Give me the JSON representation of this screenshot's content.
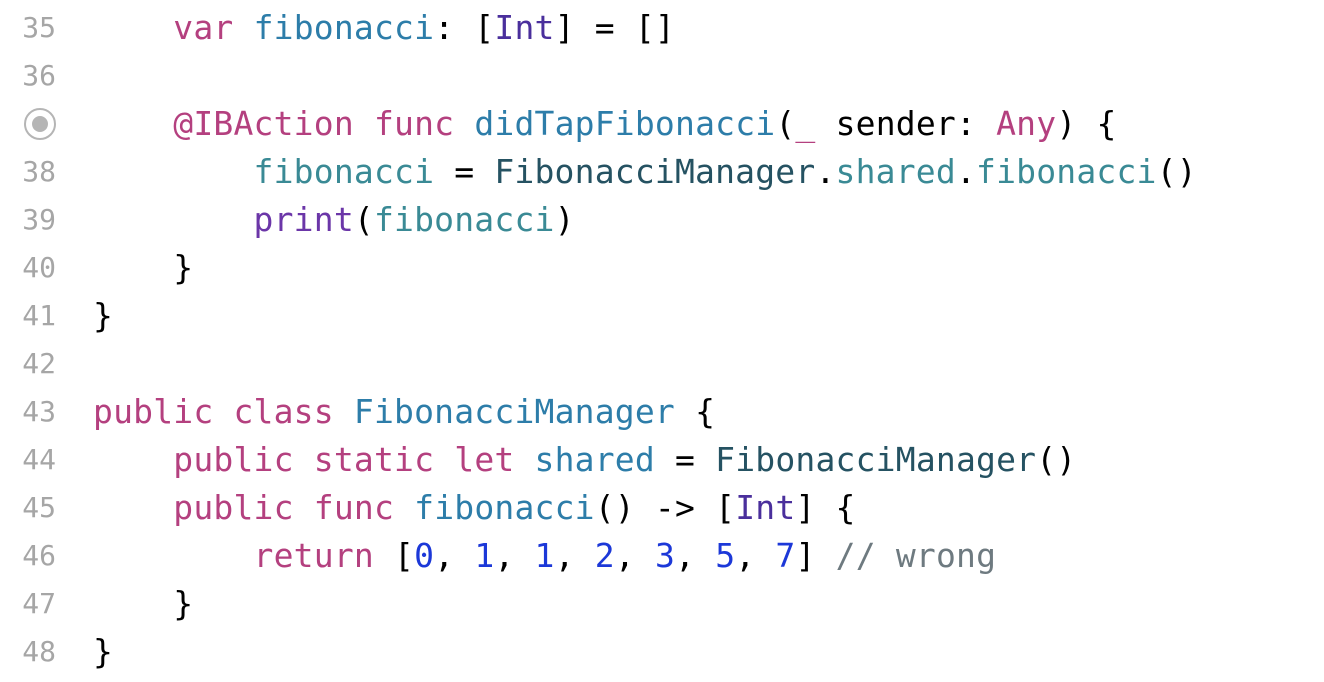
{
  "colors": {
    "keyword": "#b4407f",
    "declaration": "#2d7da9",
    "type": "#4a2f9c",
    "type_ref": "#255262",
    "member": "#3a8a95",
    "builtin_func": "#6b36a8",
    "number": "#1c38d8",
    "comment": "#6e7a80",
    "plain": "#000000",
    "line_number": "#a6a6a6"
  },
  "lines": [
    {
      "number": "35",
      "tokens": [
        {
          "text": "    "
        },
        {
          "text": "var",
          "kind": "keyword"
        },
        {
          "text": " "
        },
        {
          "text": "fibonacci",
          "kind": "declaration"
        },
        {
          "text": ": ["
        },
        {
          "text": "Int",
          "kind": "type"
        },
        {
          "text": "] = []"
        }
      ]
    },
    {
      "number": "36",
      "tokens": []
    },
    {
      "number": "",
      "breakpoint_icon": "breakpoint-connection-icon",
      "tokens": [
        {
          "text": "    "
        },
        {
          "text": "@IBAction",
          "kind": "keyword"
        },
        {
          "text": " "
        },
        {
          "text": "func",
          "kind": "keyword"
        },
        {
          "text": " "
        },
        {
          "text": "didTapFibonacci",
          "kind": "declaration"
        },
        {
          "text": "("
        },
        {
          "text": "_",
          "kind": "keyword"
        },
        {
          "text": " sender: "
        },
        {
          "text": "Any",
          "kind": "keyword"
        },
        {
          "text": ") {"
        }
      ]
    },
    {
      "number": "38",
      "tokens": [
        {
          "text": "        "
        },
        {
          "text": "fibonacci",
          "kind": "member"
        },
        {
          "text": " = "
        },
        {
          "text": "FibonacciManager",
          "kind": "type_ref"
        },
        {
          "text": "."
        },
        {
          "text": "shared",
          "kind": "member"
        },
        {
          "text": "."
        },
        {
          "text": "fibonacci",
          "kind": "member"
        },
        {
          "text": "()"
        }
      ]
    },
    {
      "number": "39",
      "tokens": [
        {
          "text": "        "
        },
        {
          "text": "print",
          "kind": "builtin_func"
        },
        {
          "text": "("
        },
        {
          "text": "fibonacci",
          "kind": "member"
        },
        {
          "text": ")"
        }
      ]
    },
    {
      "number": "40",
      "tokens": [
        {
          "text": "    }"
        }
      ]
    },
    {
      "number": "41",
      "tokens": [
        {
          "text": "}"
        }
      ]
    },
    {
      "number": "42",
      "tokens": []
    },
    {
      "number": "43",
      "tokens": [
        {
          "text": "public",
          "kind": "keyword"
        },
        {
          "text": " "
        },
        {
          "text": "class",
          "kind": "keyword"
        },
        {
          "text": " "
        },
        {
          "text": "FibonacciManager",
          "kind": "declaration"
        },
        {
          "text": " {"
        }
      ]
    },
    {
      "number": "44",
      "tokens": [
        {
          "text": "    "
        },
        {
          "text": "public",
          "kind": "keyword"
        },
        {
          "text": " "
        },
        {
          "text": "static",
          "kind": "keyword"
        },
        {
          "text": " "
        },
        {
          "text": "let",
          "kind": "keyword"
        },
        {
          "text": " "
        },
        {
          "text": "shared",
          "kind": "declaration"
        },
        {
          "text": " = "
        },
        {
          "text": "FibonacciManager",
          "kind": "type_ref"
        },
        {
          "text": "()"
        }
      ]
    },
    {
      "number": "45",
      "tokens": [
        {
          "text": "    "
        },
        {
          "text": "public",
          "kind": "keyword"
        },
        {
          "text": " "
        },
        {
          "text": "func",
          "kind": "keyword"
        },
        {
          "text": " "
        },
        {
          "text": "fibonacci",
          "kind": "declaration"
        },
        {
          "text": "() -> ["
        },
        {
          "text": "Int",
          "kind": "type"
        },
        {
          "text": "] {"
        }
      ]
    },
    {
      "number": "46",
      "tokens": [
        {
          "text": "        "
        },
        {
          "text": "return",
          "kind": "keyword"
        },
        {
          "text": " ["
        },
        {
          "text": "0",
          "kind": "number"
        },
        {
          "text": ", "
        },
        {
          "text": "1",
          "kind": "number"
        },
        {
          "text": ", "
        },
        {
          "text": "1",
          "kind": "number"
        },
        {
          "text": ", "
        },
        {
          "text": "2",
          "kind": "number"
        },
        {
          "text": ", "
        },
        {
          "text": "3",
          "kind": "number"
        },
        {
          "text": ", "
        },
        {
          "text": "5",
          "kind": "number"
        },
        {
          "text": ", "
        },
        {
          "text": "7",
          "kind": "number"
        },
        {
          "text": "] "
        },
        {
          "text": "// wrong",
          "kind": "comment"
        }
      ]
    },
    {
      "number": "47",
      "tokens": [
        {
          "text": "    }"
        }
      ]
    },
    {
      "number": "48",
      "tokens": [
        {
          "text": "}"
        }
      ]
    }
  ]
}
